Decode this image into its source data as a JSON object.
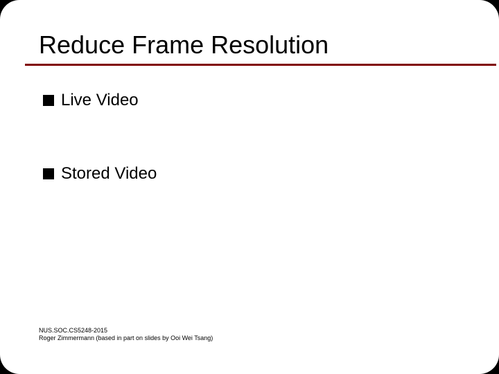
{
  "slide": {
    "title": "Reduce Frame Resolution",
    "bullets": [
      {
        "text": "Live Video"
      },
      {
        "text": "Stored Video"
      }
    ],
    "footer": {
      "line1": "NUS.SOC.CS5248-2015",
      "line2": "Roger Zimmermann (based in part on slides by Ooi Wei Tsang)"
    }
  }
}
